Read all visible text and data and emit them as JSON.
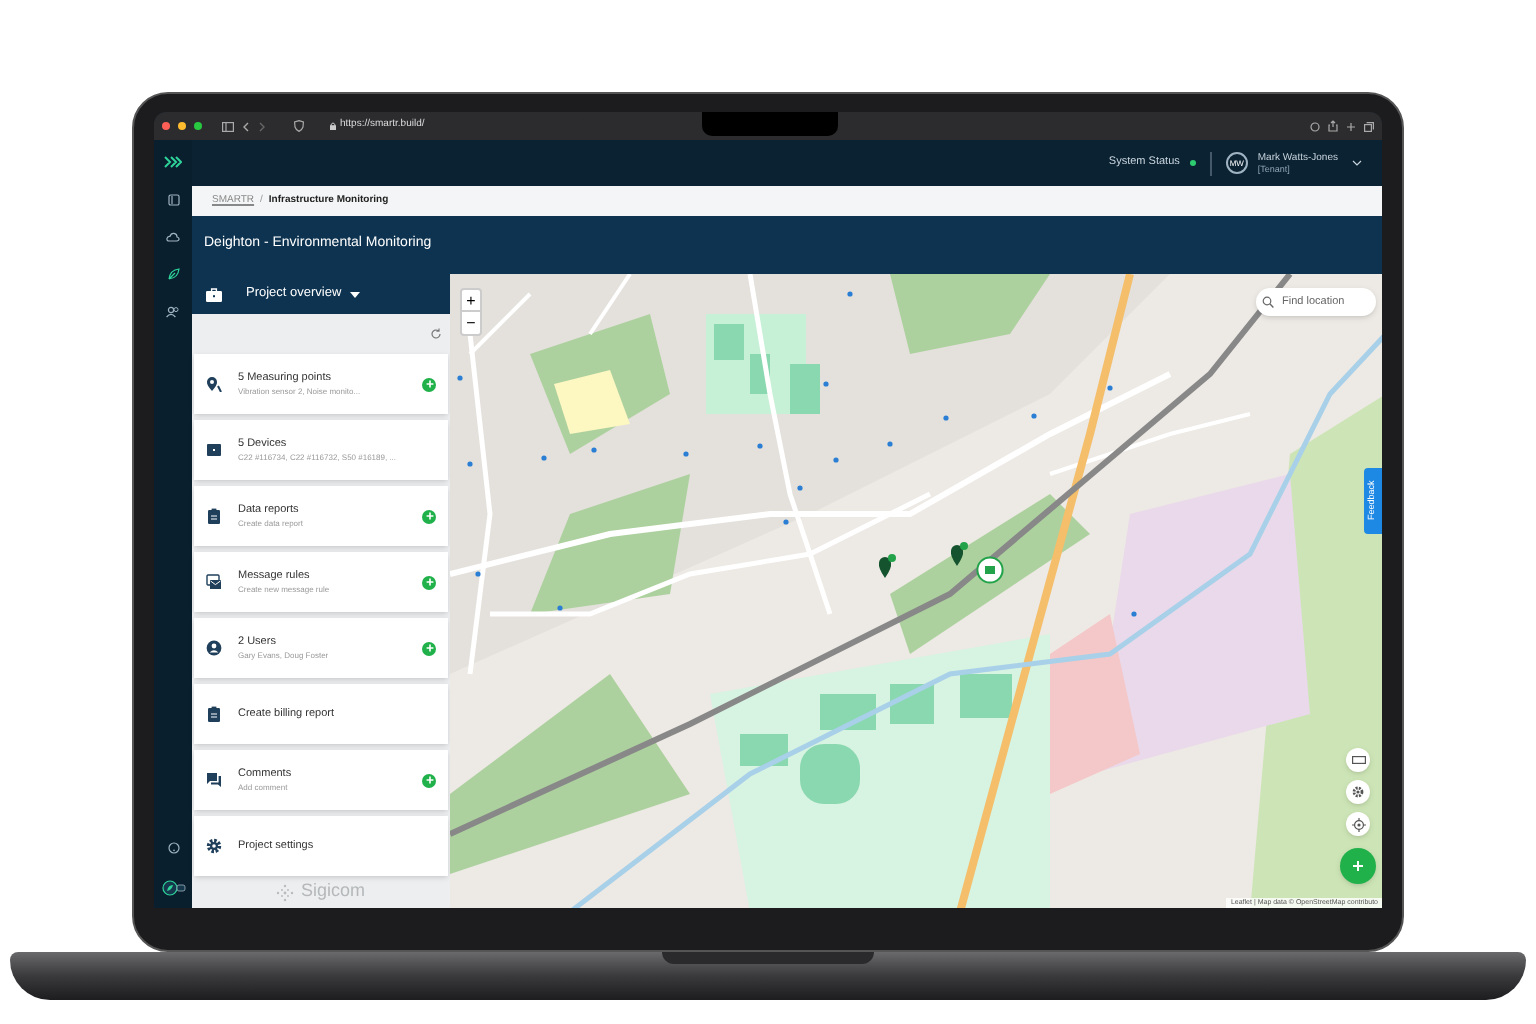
{
  "browser": {
    "url": "https://smartr.build/"
  },
  "header": {
    "system_status": {
      "label": "System Status",
      "ok": true
    },
    "user": {
      "initials": "MW",
      "name": "Mark Watts-Jones",
      "role": "[Tenant]"
    }
  },
  "breadcrumb_separator": "/",
  "breadcrumb": [
    {
      "label": "SMARTR",
      "current": false
    },
    {
      "label": "Infrastructure Monitoring",
      "current": true
    }
  ],
  "page_title": "Deighton - Environmental Monitoring",
  "panel": {
    "title": "Project overview",
    "items": [
      {
        "title": "5 Measuring points",
        "subtitle": "Vibration sensor 2, Noise monito...",
        "add": true
      },
      {
        "title": "5 Devices",
        "subtitle": "C22 #116734, C22 #116732, S50 #16189, ...",
        "add": false
      },
      {
        "title": "Data reports",
        "subtitle": "Create data report",
        "add": true
      },
      {
        "title": "Message rules",
        "subtitle": "Create new message rule",
        "add": true
      },
      {
        "title": "2 Users",
        "subtitle": "Gary Evans, Doug Foster",
        "add": true
      },
      {
        "title": "Create billing report",
        "add": false
      },
      {
        "title": "Comments",
        "subtitle": "Add comment",
        "add": true
      },
      {
        "title": "Project settings",
        "add": false
      }
    ],
    "footer_logo": "Sigicom"
  },
  "map": {
    "zoom_in": "+",
    "zoom_out": "−",
    "search": {
      "placeholder": "Find location"
    },
    "feedback_tab": "Feedback",
    "attribution": "Leaflet | Map data © OpenStreetMap contributo"
  }
}
